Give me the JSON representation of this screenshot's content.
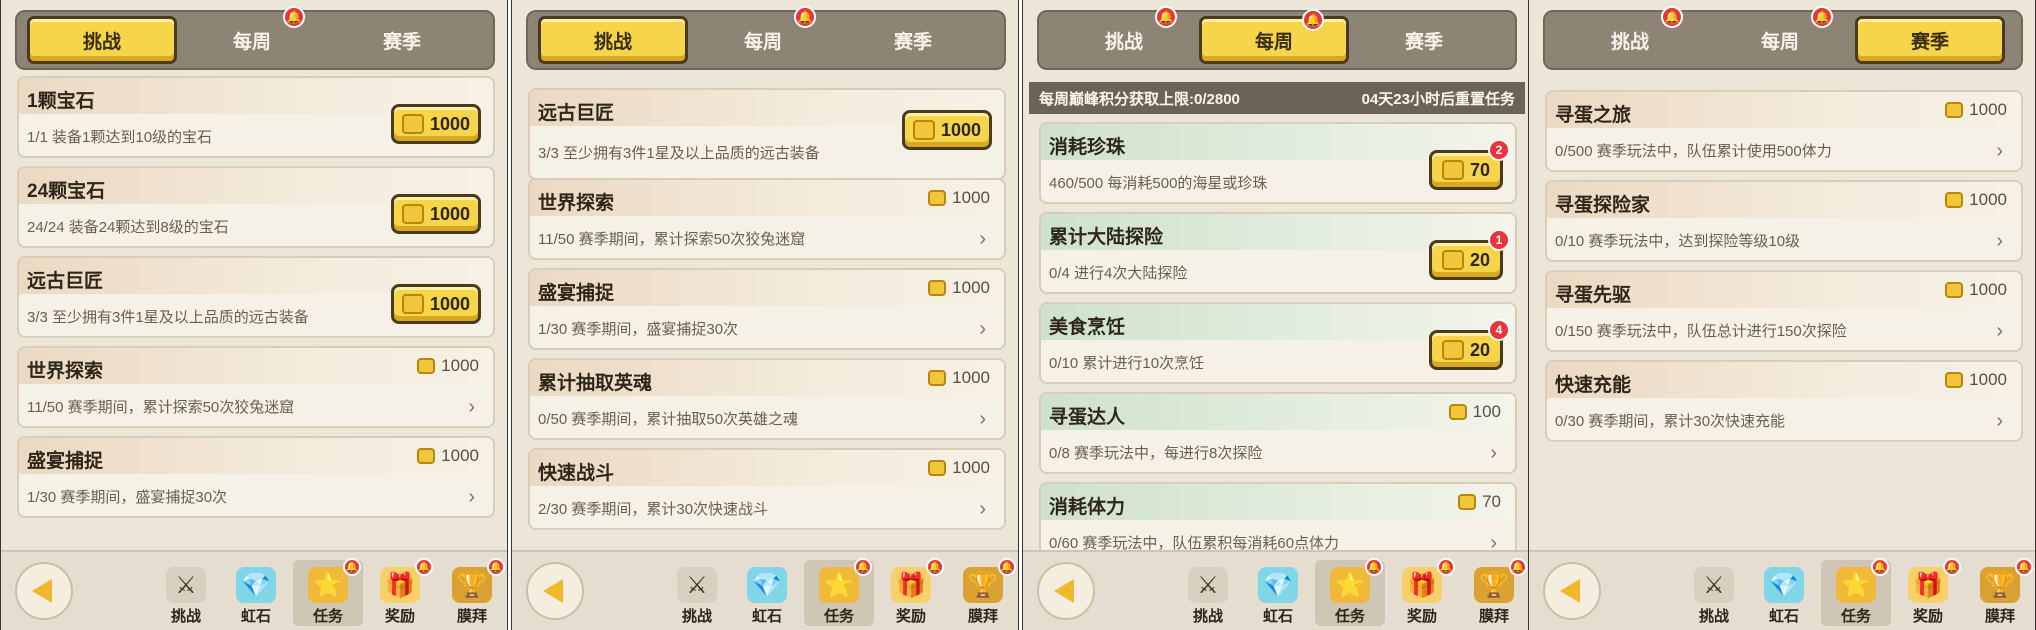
{
  "tabs": [
    "挑战",
    "每周",
    "赛季"
  ],
  "nav": [
    "挑战",
    "虹石",
    "任务",
    "奖励",
    "膜拜"
  ],
  "icons": {
    "bell": "🔔",
    "coin": "coin-icon",
    "arrow": "›",
    "back": "back-arrow-icon",
    "nav": [
      "⚔",
      "💎",
      "⭐",
      "🎁",
      "🏆"
    ]
  },
  "colors": {
    "accent": "#f6d54a",
    "badge": "#e8343a",
    "panel_bg": "#ece6d9"
  },
  "panels": [
    {
      "active_tab": "挑战",
      "tasks": [
        {
          "title": "1颗宝石",
          "desc": "1/1 装备1颗达到10级的宝石",
          "reward": "1000",
          "claimable": true
        },
        {
          "title": "24颗宝石",
          "desc": "24/24 装备24颗达到8级的宝石",
          "reward": "1000",
          "claimable": true
        },
        {
          "title": "远古巨匠",
          "desc": "3/3 至少拥有3件1星及以上品质的远古装备",
          "reward": "1000",
          "claimable": true
        },
        {
          "title": "世界探索",
          "desc": "11/50 赛季期间，累计探索50次狡兔迷窟",
          "reward": "1000",
          "claimable": false
        },
        {
          "title": "盛宴捕捉",
          "desc": "1/30 赛季期间，盛宴捕捉30次",
          "reward": "1000",
          "claimable": false
        }
      ]
    },
    {
      "active_tab": "挑战",
      "tasks": [
        {
          "title": "远古巨匠",
          "desc": "3/3 至少拥有3件1星及以上品质的远古装备",
          "reward": "1000",
          "claimable": true
        },
        {
          "title": "世界探索",
          "desc": "11/50 赛季期间，累计探索50次狡兔迷窟",
          "reward": "1000",
          "claimable": false
        },
        {
          "title": "盛宴捕捉",
          "desc": "1/30 赛季期间，盛宴捕捉30次",
          "reward": "1000",
          "claimable": false
        },
        {
          "title": "累计抽取英魂",
          "desc": "0/50 赛季期间，累计抽取50次英雄之魂",
          "reward": "1000",
          "claimable": false
        },
        {
          "title": "快速战斗",
          "desc": "2/30 赛季期间，累计30次快速战斗",
          "reward": "1000",
          "claimable": false
        }
      ]
    },
    {
      "active_tab": "每周",
      "quota_left": "每周巅峰积分获取上限:0/2800",
      "quota_right": "04天23小时后重置任务",
      "tasks": [
        {
          "title": "消耗珍珠",
          "desc": "460/500 每消耗500的海星或珍珠",
          "reward": "70",
          "claimable": true,
          "badge": "2"
        },
        {
          "title": "累计大陆探险",
          "desc": "0/4 进行4次大陆探险",
          "reward": "20",
          "claimable": true,
          "badge": "1"
        },
        {
          "title": "美食烹饪",
          "desc": "0/10 累计进行10次烹饪",
          "reward": "20",
          "claimable": true,
          "badge": "4"
        },
        {
          "title": "寻蛋达人",
          "desc": "0/8 赛季玩法中，每进行8次探险",
          "reward": "100",
          "claimable": false
        },
        {
          "title": "消耗体力",
          "desc": "0/60 赛季玩法中，队伍累积每消耗60点体力",
          "reward": "70",
          "claimable": false
        }
      ]
    },
    {
      "active_tab": "赛季",
      "tasks": [
        {
          "title": "寻蛋之旅",
          "desc": "0/500 赛季玩法中，队伍累计使用500体力",
          "reward": "1000",
          "claimable": false
        },
        {
          "title": "寻蛋探险家",
          "desc": "0/10 赛季玩法中，达到探险等级10级",
          "reward": "1000",
          "claimable": false
        },
        {
          "title": "寻蛋先驱",
          "desc": "0/150 赛季玩法中，队伍总计进行150次探险",
          "reward": "1000",
          "claimable": false
        },
        {
          "title": "快速充能",
          "desc": "0/30 赛季期间，累计30次快速充能",
          "reward": "1000",
          "claimable": false
        }
      ]
    }
  ]
}
